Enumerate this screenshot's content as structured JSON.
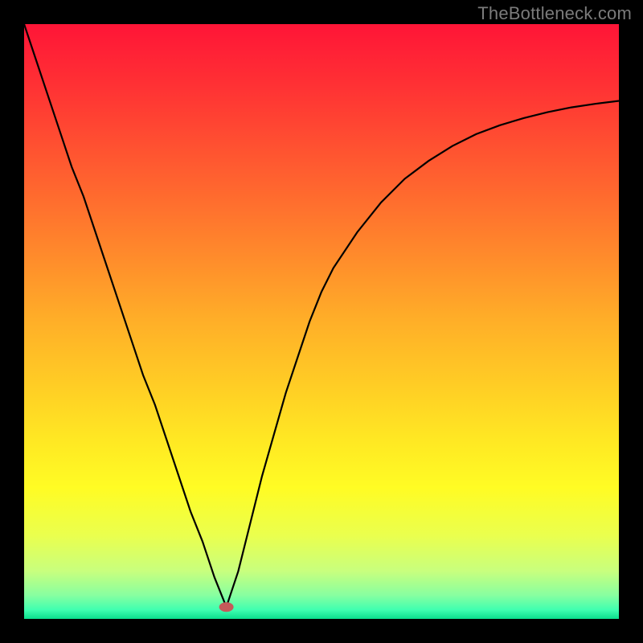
{
  "watermark": "TheBottleneck.com",
  "chart_data": {
    "type": "line",
    "title": "",
    "xlabel": "",
    "ylabel": "",
    "xlim": [
      0,
      100
    ],
    "ylim": [
      0,
      100
    ],
    "x_min_at": 34,
    "marker": {
      "x": 34,
      "y": 2,
      "color": "#c55a5a"
    },
    "background_gradient": {
      "stops": [
        {
          "offset": 0.0,
          "color": "#ff1537"
        },
        {
          "offset": 0.1,
          "color": "#ff3034"
        },
        {
          "offset": 0.2,
          "color": "#ff4f31"
        },
        {
          "offset": 0.3,
          "color": "#ff6e2e"
        },
        {
          "offset": 0.4,
          "color": "#ff8e2b"
        },
        {
          "offset": 0.5,
          "color": "#ffaf28"
        },
        {
          "offset": 0.6,
          "color": "#ffcb25"
        },
        {
          "offset": 0.7,
          "color": "#ffe823"
        },
        {
          "offset": 0.78,
          "color": "#fffc24"
        },
        {
          "offset": 0.86,
          "color": "#eaff4e"
        },
        {
          "offset": 0.92,
          "color": "#c8ff7e"
        },
        {
          "offset": 0.96,
          "color": "#88ffa0"
        },
        {
          "offset": 0.985,
          "color": "#3fffb0"
        },
        {
          "offset": 1.0,
          "color": "#0bde8d"
        }
      ]
    },
    "series": [
      {
        "name": "curve",
        "color": "#000000",
        "x": [
          0,
          2,
          4,
          6,
          8,
          10,
          12,
          14,
          16,
          18,
          20,
          22,
          24,
          26,
          28,
          30,
          32,
          34,
          36,
          38,
          40,
          42,
          44,
          46,
          48,
          50,
          52,
          56,
          60,
          64,
          68,
          72,
          76,
          80,
          84,
          88,
          92,
          96,
          100
        ],
        "values": [
          100,
          94,
          88,
          82,
          76,
          71,
          65,
          59,
          53,
          47,
          41,
          36,
          30,
          24,
          18,
          13,
          7,
          2,
          8,
          16,
          24,
          31,
          38,
          44,
          50,
          55,
          59,
          65,
          70,
          74,
          77,
          79.5,
          81.5,
          83,
          84.2,
          85.2,
          86,
          86.6,
          87.1
        ]
      }
    ]
  }
}
